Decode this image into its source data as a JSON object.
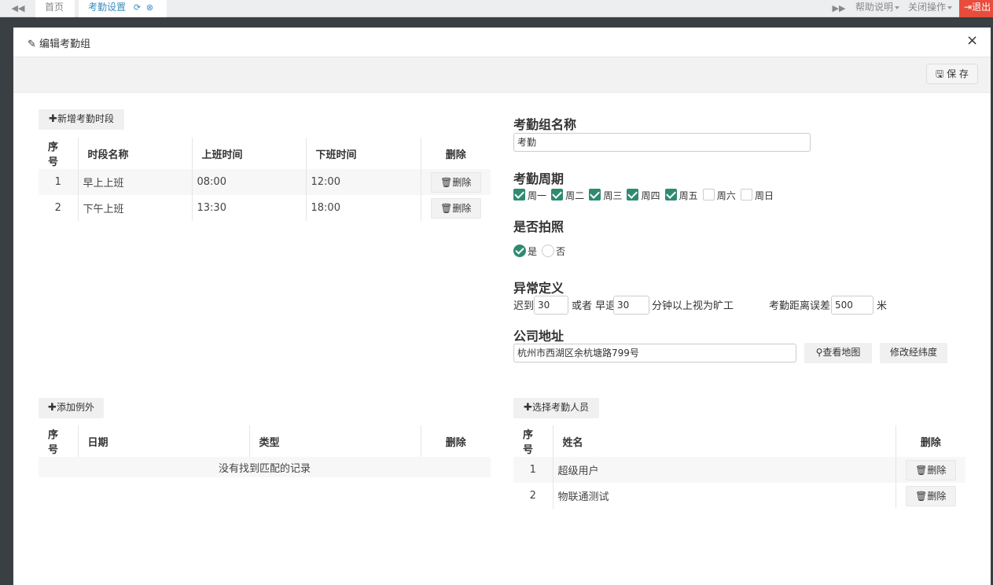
{
  "topbar": {
    "tabs": [
      {
        "label": "首页"
      },
      {
        "label": "考勤设置"
      }
    ],
    "help_label": "帮助说明",
    "close_ops_label": "关闭操作",
    "logout_label": "退出"
  },
  "modal": {
    "title": "编辑考勤组",
    "close_glyph": "×",
    "save_label": "保 存"
  },
  "periods": {
    "add_label": "新增考勤时段",
    "headers": [
      "序号",
      "时段名称",
      "上班时间",
      "下班时间",
      "删除"
    ],
    "rows": [
      {
        "no": "1",
        "name": "早上上班",
        "start": "08:00",
        "end": "12:00",
        "del": "删除"
      },
      {
        "no": "2",
        "name": "下午上班",
        "start": "13:30",
        "end": "18:00",
        "del": "删除"
      }
    ]
  },
  "exceptions": {
    "add_label": "添加例外",
    "headers": [
      "序号",
      "日期",
      "类型",
      "删除"
    ],
    "empty_text": "没有找到匹配的记录"
  },
  "form": {
    "group_name_label": "考勤组名称",
    "group_name_value": "考勤",
    "cycle_label": "考勤周期",
    "days": [
      {
        "label": "周一",
        "checked": true
      },
      {
        "label": "周二",
        "checked": true
      },
      {
        "label": "周三",
        "checked": true
      },
      {
        "label": "周四",
        "checked": true
      },
      {
        "label": "周五",
        "checked": true
      },
      {
        "label": "周六",
        "checked": false
      },
      {
        "label": "周日",
        "checked": false
      }
    ],
    "photo_label": "是否拍照",
    "photo_yes": "是",
    "photo_no": "否",
    "photo_selected": "是",
    "abnormal_label": "异常定义",
    "late_label": "迟到",
    "late_value": "30",
    "or_early_label": "或者 早退",
    "early_value": "30",
    "absent_label": "分钟以上视为旷工",
    "distance_label": "考勤距离误差",
    "distance_value": "500",
    "distance_unit": "米",
    "address_label": "公司地址",
    "address_value": "杭州市西湖区余杭塘路799号",
    "view_map_label": "查看地图",
    "edit_coords_label": "修改经纬度"
  },
  "members": {
    "add_label": "选择考勤人员",
    "headers": [
      "序号",
      "姓名",
      "删除"
    ],
    "rows": [
      {
        "no": "1",
        "name": "超级用户",
        "del": "删除"
      },
      {
        "no": "2",
        "name": "物联通测试",
        "del": "删除"
      }
    ]
  },
  "colors": {
    "accent": "#2e8b72",
    "link": "#3c8dbc",
    "logout": "#e74c3c"
  }
}
